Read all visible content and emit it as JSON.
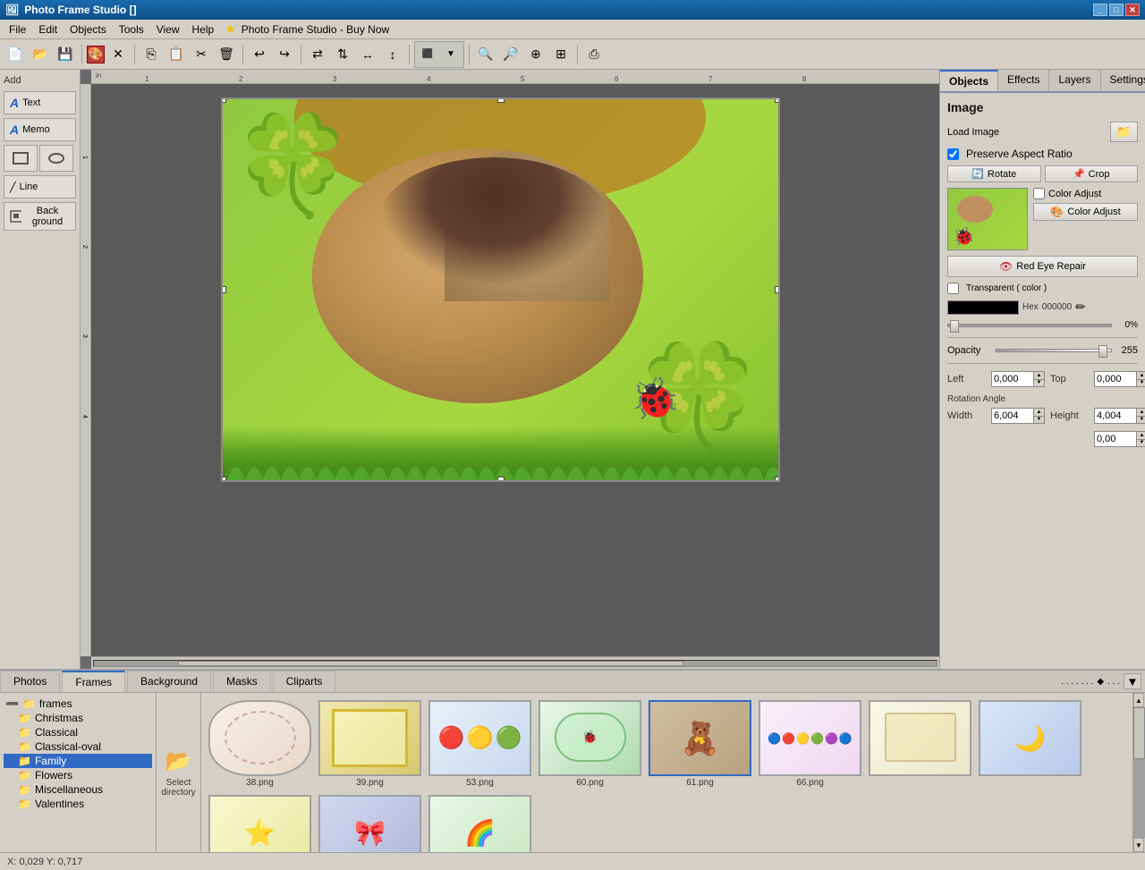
{
  "titlebar": {
    "title": "Photo Frame Studio []",
    "icon": "🖼",
    "controls": [
      "_",
      "□",
      "✕"
    ]
  },
  "menubar": {
    "items": [
      "File",
      "Edit",
      "Objects",
      "Tools",
      "View",
      "Help"
    ],
    "star": "★",
    "app_title": "Photo Frame Studio - Buy Now"
  },
  "toolbar": {
    "buttons": [
      "new",
      "open",
      "save",
      "sep",
      "color-picker",
      "close",
      "sep2",
      "copy",
      "paste",
      "cut",
      "delete",
      "sep3",
      "undo",
      "redo",
      "sep4",
      "flip-h",
      "flip-v",
      "sep5",
      "group",
      "ungroup",
      "sep6",
      "zoom-in",
      "zoom-out",
      "zoom-100",
      "zoom-fit",
      "sep7",
      "export"
    ]
  },
  "left_panel": {
    "add_label": "Add",
    "tools": [
      {
        "name": "text-tool",
        "label": "Text",
        "icon": "A"
      },
      {
        "name": "memo-tool",
        "label": "Memo",
        "icon": "A"
      },
      {
        "name": "rect-tool",
        "label": "□"
      },
      {
        "name": "oval-tool",
        "label": "○"
      },
      {
        "name": "line-tool",
        "label": "Line",
        "icon": "╱"
      },
      {
        "name": "background-tool",
        "label": "Back ground",
        "icon": "□"
      }
    ]
  },
  "canvas": {
    "ruler_unit": "in",
    "x_marks": [
      "1",
      "2",
      "3",
      "4",
      "5",
      "6",
      "7",
      "8"
    ],
    "y_marks": [
      "1",
      "2",
      "3",
      "4"
    ],
    "status": "X: 0,029 Y: 0,717"
  },
  "right_panel": {
    "tabs": [
      {
        "name": "tab-objects",
        "label": "Objects",
        "active": true
      },
      {
        "name": "tab-effects",
        "label": "Effects",
        "active": false
      },
      {
        "name": "tab-layers",
        "label": "Layers",
        "active": false
      },
      {
        "name": "tab-settings",
        "label": "Settings",
        "active": false
      }
    ],
    "image_section": {
      "title": "Image",
      "load_image_label": "Load Image",
      "preserve_aspect": "Preserve Aspect Ratio",
      "preserve_checked": true,
      "rotate_label": "Rotate",
      "crop_label": "Crop",
      "color_adjust_label": "Color Adjust",
      "color_adjust_check": false,
      "red_eye_label": "Red Eye Repair",
      "transparent_label": "Transparent ( color )",
      "transparent_check": false,
      "hex_label": "Hex",
      "hex_value": "000000",
      "percent_value": "0%",
      "opacity_label": "Opacity",
      "opacity_value": "255"
    },
    "position": {
      "left_label": "Left",
      "left_value": "0,000",
      "top_label": "Top",
      "top_value": "0,000",
      "rotation_label": "Rotation Angle",
      "rotation_value": "0,00",
      "width_label": "Width",
      "width_value": "6,004",
      "height_label": "Height",
      "height_value": "4,004"
    }
  },
  "bottom_panel": {
    "tabs": [
      {
        "name": "tab-photos",
        "label": "Photos",
        "active": false
      },
      {
        "name": "tab-frames",
        "label": "Frames",
        "active": true
      },
      {
        "name": "tab-background",
        "label": "Background",
        "active": false
      },
      {
        "name": "tab-masks",
        "label": "Masks",
        "active": false
      },
      {
        "name": "tab-clipart",
        "label": "Cliparts",
        "active": false
      }
    ],
    "tree": {
      "root": "frames",
      "items": [
        {
          "name": "Christmas",
          "indent": 1
        },
        {
          "name": "Classical",
          "indent": 1
        },
        {
          "name": "Classical-oval",
          "indent": 1
        },
        {
          "name": "Family",
          "indent": 1,
          "selected": true
        },
        {
          "name": "Flowers",
          "indent": 1
        },
        {
          "name": "Miscellaneous",
          "indent": 1
        },
        {
          "name": "Valentines",
          "indent": 1
        }
      ]
    },
    "select_dir_label": "Select directory",
    "thumbnails": [
      {
        "name": "38.png",
        "label": "38.png"
      },
      {
        "name": "39.png",
        "label": "39.png"
      },
      {
        "name": "53.png",
        "label": "53.png"
      },
      {
        "name": "60.png",
        "label": "60.png"
      },
      {
        "name": "61.png",
        "label": "61.png",
        "selected": true
      },
      {
        "name": "66.png",
        "label": "66.png"
      }
    ],
    "thumbnails_row2": [
      {
        "name": "r2-1",
        "label": ""
      },
      {
        "name": "r2-2",
        "label": ""
      },
      {
        "name": "r2-3",
        "label": ""
      },
      {
        "name": "r2-4",
        "label": ""
      },
      {
        "name": "r2-5",
        "label": ""
      }
    ]
  },
  "statusbar": {
    "coords": "X: 0,029 Y: 0,717"
  }
}
